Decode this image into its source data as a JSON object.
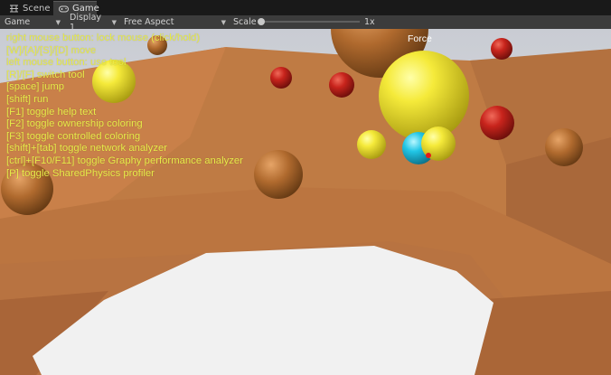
{
  "tabs": [
    {
      "label": "Scene",
      "icon": "scene-grid-icon",
      "active": false
    },
    {
      "label": "Game",
      "icon": "gamepad-icon",
      "active": true
    }
  ],
  "toolbar": {
    "view_select": "Game",
    "display_select": "Display 1",
    "aspect_select": "Free Aspect",
    "scale_label": "Scale",
    "scale_value": "1x"
  },
  "game": {
    "help_lines": [
      "right mouse button: lock mouse (click/hold)",
      "[W]/[A]/[S]/[D] move",
      "left mouse button: use tool",
      "[R]/[F] switch tool",
      "[space] jump",
      "[shift] run",
      "[F1] toggle help text",
      "[F2] toggle ownership coloring",
      "[F3] toggle controlled coloring",
      "[shift]+[tab] toggle network analyzer",
      "[ctrl]+[F10/F11] toggle Graphy performance analyzer",
      "[P] toggle SharedPhysics profiler"
    ],
    "tool_label": "Force"
  },
  "colors": {
    "help_text": "#e9ec4a",
    "terrain": "#c07a42",
    "floor": "#f1f1f1",
    "editor_bg": "#3c3c3c"
  }
}
